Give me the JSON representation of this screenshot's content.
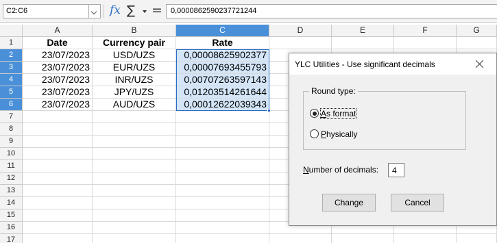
{
  "formula_bar": {
    "name_box": "C2:C6",
    "fx_symbol": "fx",
    "sigma_symbol": "∑",
    "equals_symbol": "=",
    "content": "0,0000862590237721244"
  },
  "sheet": {
    "columns": [
      "A",
      "B",
      "C",
      "D",
      "E",
      "F",
      "G"
    ],
    "rows": [
      "1",
      "2",
      "3",
      "4",
      "5",
      "6",
      "7",
      "8",
      "9",
      "10",
      "11",
      "12",
      "13",
      "14",
      "15",
      "16",
      "17"
    ],
    "headers": {
      "date": "Date",
      "pair": "Currency pair",
      "rate": "Rate"
    },
    "data": [
      {
        "date": "23/07/2023",
        "pair": "USD/UZS",
        "rate": "0,00008625902377"
      },
      {
        "date": "23/07/2023",
        "pair": "EUR/UZS",
        "rate": "0,00007693455793"
      },
      {
        "date": "23/07/2023",
        "pair": "INR/UZS",
        "rate": "0,00707263597143"
      },
      {
        "date": "23/07/2023",
        "pair": "JPY/UZS",
        "rate": "0,01203514261644"
      },
      {
        "date": "23/07/2023",
        "pair": "AUD/UZS",
        "rate": "0,00012622039343"
      }
    ],
    "selected_column": "C",
    "selected_range": "C2:C6"
  },
  "dialog": {
    "title": "YLC Utilities - Use significant decimals",
    "round_type_label": "Round type:",
    "option_as_format_pre": "",
    "option_as_format_u": "A",
    "option_as_format_post": "s format",
    "option_physically_pre": "",
    "option_physically_u": "P",
    "option_physically_post": "hysically",
    "selected_option": "As format",
    "decimals_label_u": "N",
    "decimals_label_post": "umber of decimals:",
    "decimals_value": "4",
    "change_label": "Change",
    "cancel_label": "Cancel"
  },
  "icons": {
    "dropdown": "chevron-down-icon",
    "close": "close-icon",
    "function": "function-wizard-icon",
    "sum": "sum-icon"
  },
  "colors": {
    "selection_header": "#4a90d9",
    "selection_fill": "#d3e5f7",
    "selection_border": "#2a6bc4"
  }
}
